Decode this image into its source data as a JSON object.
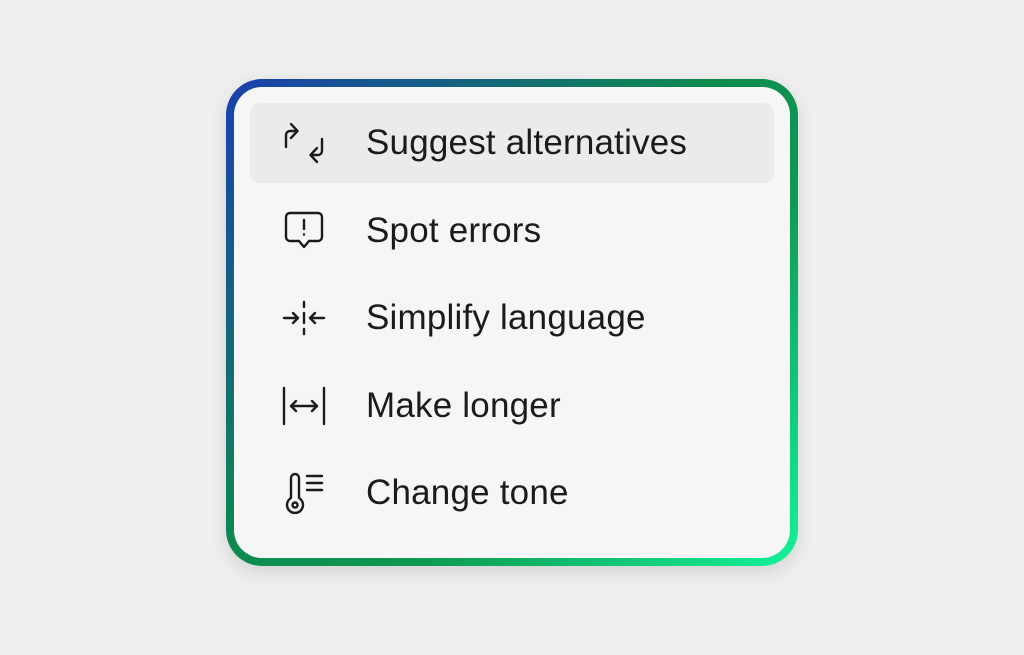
{
  "menu": {
    "items": [
      {
        "label": "Suggest alternatives",
        "icon": "repeat-icon",
        "active": true
      },
      {
        "label": "Spot errors",
        "icon": "alert-message-icon",
        "active": false
      },
      {
        "label": "Simplify language",
        "icon": "compress-arrows-icon",
        "active": false
      },
      {
        "label": "Make longer",
        "icon": "expand-width-icon",
        "active": false
      },
      {
        "label": "Change tone",
        "icon": "thermometer-icon",
        "active": false
      }
    ]
  },
  "colors": {
    "background": "#efefef",
    "panel": "#f6f6f6",
    "highlight": "#ebebeb",
    "text": "#1b1b1b",
    "border_gradient_start": "#1a3fb0",
    "border_gradient_mid": "#0d8a4e",
    "border_gradient_end": "#14f29a"
  }
}
